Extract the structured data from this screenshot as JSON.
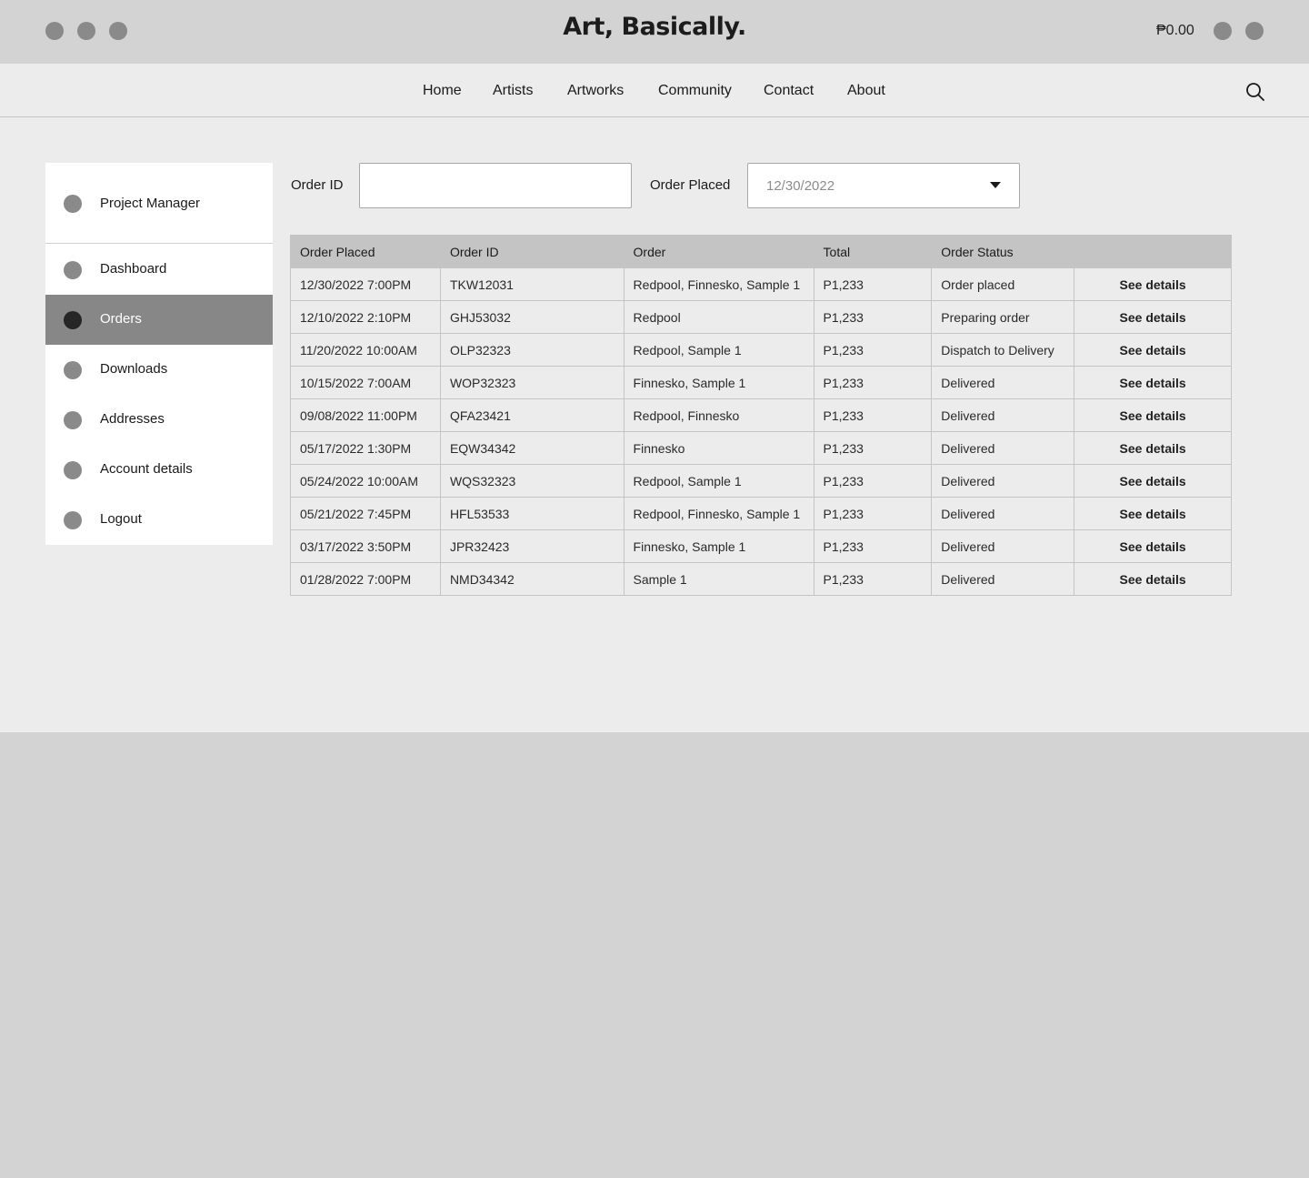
{
  "header": {
    "brand": "Art, Basically.",
    "cart_total": "₱0.00"
  },
  "nav": {
    "items": [
      "Home",
      "Artists",
      "Artworks",
      "Community",
      "Contact",
      "About"
    ]
  },
  "sidebar": {
    "profile": "Project Manager",
    "items": [
      "Dashboard",
      "Orders",
      "Downloads",
      "Addresses",
      "Account details",
      "Logout"
    ],
    "active": "Orders"
  },
  "filters": {
    "order_id_label": "Order ID",
    "order_id_value": "",
    "order_placed_label": "Order Placed",
    "order_placed_value": "12/30/2022"
  },
  "table": {
    "headers": [
      "Order Placed",
      "Order ID",
      "Order",
      "Total",
      "Order Status",
      ""
    ],
    "rows": [
      [
        "12/30/2022 7:00PM",
        "TKW12031",
        "Redpool, Finnesko, Sample 1",
        "P1,233",
        "Order placed",
        "See details"
      ],
      [
        "12/10/2022 2:10PM",
        "GHJ53032",
        "Redpool",
        "P1,233",
        "Preparing order",
        "See details"
      ],
      [
        "11/20/2022 10:00AM",
        "OLP32323",
        "Redpool, Sample 1",
        "P1,233",
        "Dispatch to Delivery",
        "See details"
      ],
      [
        "10/15/2022 7:00AM",
        "WOP32323",
        "Finnesko, Sample 1",
        "P1,233",
        "Delivered",
        "See details"
      ],
      [
        "09/08/2022 11:00PM",
        "QFA23421",
        "Redpool, Finnesko",
        "P1,233",
        "Delivered",
        "See details"
      ],
      [
        "05/17/2022 1:30PM",
        "EQW34342",
        "Finnesko",
        "P1,233",
        "Delivered",
        "See details"
      ],
      [
        "05/24/2022 10:00AM",
        "WQS32323",
        "Redpool, Sample 1",
        "P1,233",
        "Delivered",
        "See details"
      ],
      [
        "05/21/2022 7:45PM",
        "HFL53533",
        "Redpool, Finnesko, Sample 1",
        "P1,233",
        "Delivered",
        "See details"
      ],
      [
        "03/17/2022 3:50PM",
        "JPR32423",
        "Finnesko, Sample 1",
        "P1,233",
        "Delivered",
        "See details"
      ],
      [
        "01/28/2022 7:00PM",
        "NMD34342",
        "Sample 1",
        "P1,233",
        "Delivered",
        "See details"
      ]
    ]
  },
  "icons": {
    "search": "search-icon",
    "dropdown": "chevron-down-icon"
  },
  "colors": {
    "header_bg": "#d3d3d3",
    "content_bg": "#ececec",
    "active_item_bg": "#878787",
    "table_header_bg": "#c4c4c4"
  }
}
